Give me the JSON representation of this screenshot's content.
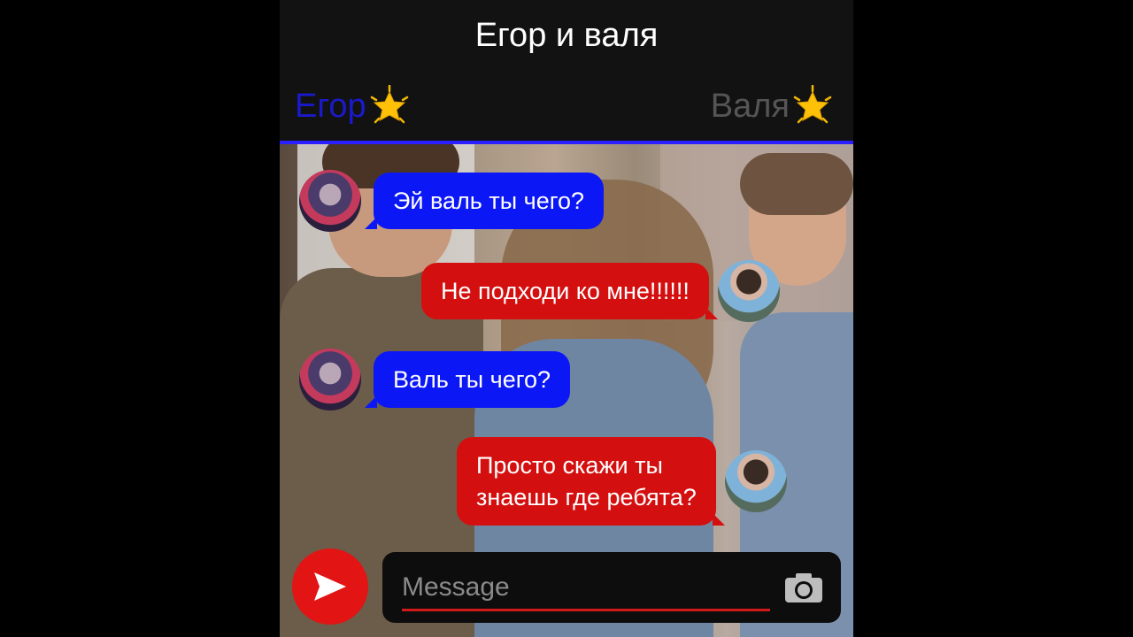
{
  "header": {
    "title": "Егор и валя",
    "left_name": "Егор",
    "right_name": "Валя",
    "left_name_color": "#1a1acc",
    "right_name_color": "#555555",
    "star_icon": "glowing-star-icon"
  },
  "messages": [
    {
      "sender": "Егор",
      "text": "Эй валь ты чего?",
      "color": "#0c17f5"
    },
    {
      "sender": "Валя",
      "text": "Не подходи ко мне!!!!!!",
      "color": "#d40f0f"
    },
    {
      "sender": "Егор",
      "text": "Валь ты чего?",
      "color": "#0c17f5"
    },
    {
      "sender": "Валя",
      "text_line1": "Просто скажи ты",
      "text_line2": "знаешь где ребята?",
      "color": "#d40f0f"
    }
  ],
  "composer": {
    "placeholder": "Message",
    "send_icon": "send-icon",
    "camera_icon": "camera-icon",
    "accent": "#e21414"
  }
}
